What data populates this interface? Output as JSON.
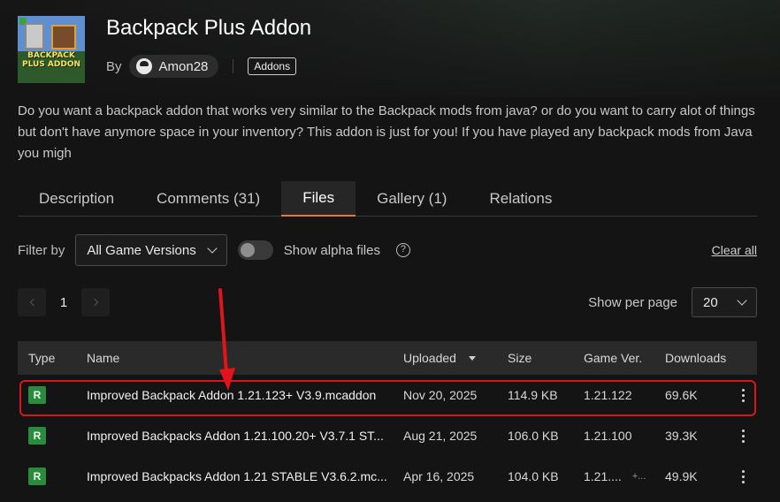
{
  "addon": {
    "title": "Backpack Plus Addon",
    "thumbnail_text": "BACKPACK PLUS ADDON",
    "by_label": "By",
    "author": "Amon28",
    "category": "Addons",
    "description": "Do you want a backpack addon that works very similar to the Backpack mods from java? or do you want to carry alot of things but don't have anymore space in your inventory? This addon is just for you! If you have played any backpack mods from Java you migh"
  },
  "tabs": [
    {
      "label": "Description",
      "active": false
    },
    {
      "label": "Comments (31)",
      "active": false
    },
    {
      "label": "Files",
      "active": true
    },
    {
      "label": "Gallery (1)",
      "active": false
    },
    {
      "label": "Relations",
      "active": false
    }
  ],
  "filters": {
    "filter_label": "Filter by",
    "game_version": "All Game Versions",
    "alpha_label": "Show alpha files",
    "alpha_enabled": false,
    "help_glyph": "?",
    "clear_all": "Clear all"
  },
  "pagination": {
    "current_page": "1",
    "per_page_label": "Show per page",
    "per_page_value": "20"
  },
  "table": {
    "headers": {
      "type": "Type",
      "name": "Name",
      "uploaded": "Uploaded",
      "size": "Size",
      "game_ver": "Game Ver.",
      "downloads": "Downloads"
    },
    "rows": [
      {
        "type": "R",
        "name": "Improved Backpack Addon 1.21.123+ V3.9.mcaddon",
        "uploaded": "Nov 20, 2025",
        "size": "114.9 KB",
        "game_ver": "1.21.122",
        "game_ver_more": "",
        "downloads": "69.6K"
      },
      {
        "type": "R",
        "name": "Improved Backpacks Addon 1.21.100.20+ V3.7.1 ST...",
        "uploaded": "Aug 21, 2025",
        "size": "106.0 KB",
        "game_ver": "1.21.100",
        "game_ver_more": "",
        "downloads": "39.3K"
      },
      {
        "type": "R",
        "name": "Improved Backpacks Addon 1.21 STABLE V3.6.2.mc...",
        "uploaded": "Apr 16, 2025",
        "size": "104.0 KB",
        "game_ver": "1.21....",
        "game_ver_more": "+...",
        "downloads": "49.9K"
      }
    ]
  },
  "annotation": {
    "highlight_color": "#d9161c",
    "arrow_color": "#e0141a"
  },
  "colors": {
    "background": "#141414",
    "accent_tab": "#e8763a",
    "release_badge": "#2a8a3e"
  }
}
